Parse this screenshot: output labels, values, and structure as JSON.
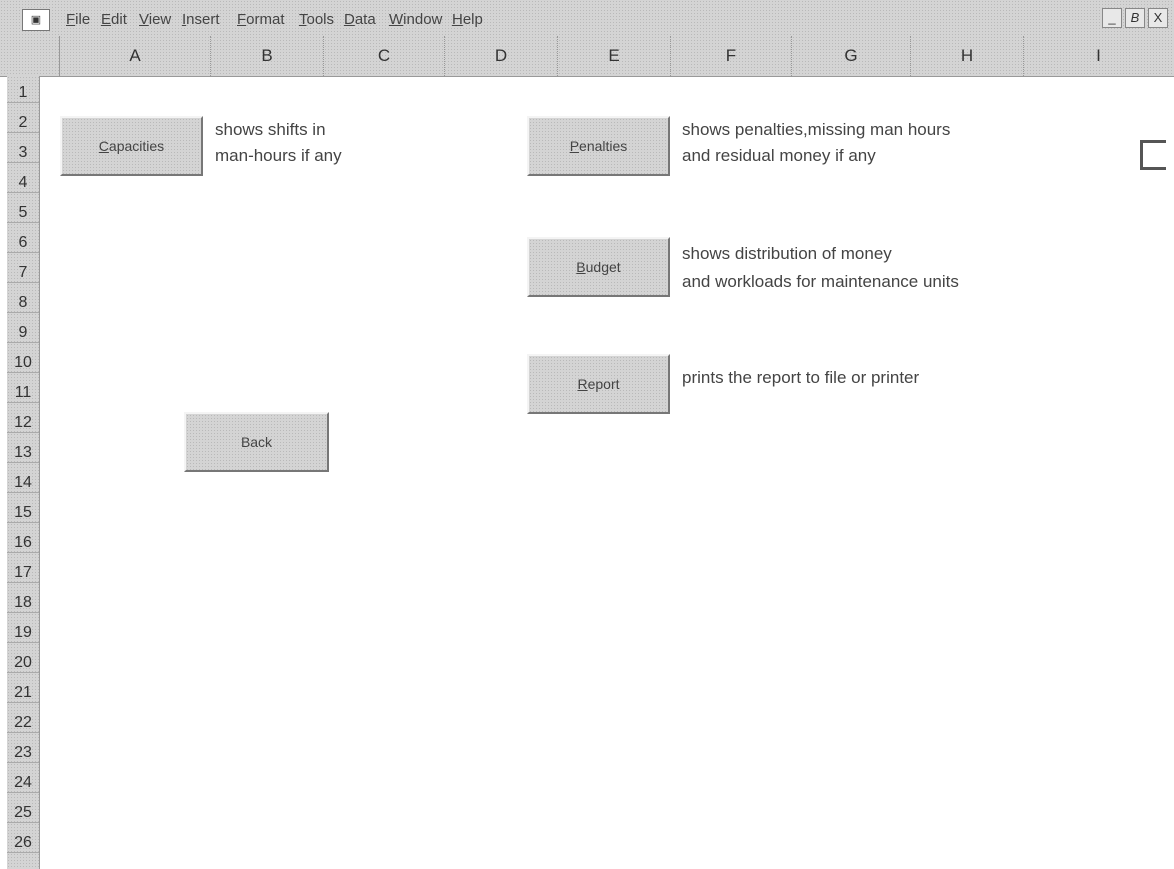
{
  "menu": {
    "app_icon": "▣",
    "items": [
      "File",
      "Edit",
      "View",
      "Insert",
      "Format",
      "Tools",
      "Data",
      "Window",
      "Help"
    ],
    "window_buttons": [
      "_",
      "B",
      "X"
    ]
  },
  "columns": [
    "A",
    "B",
    "C",
    "D",
    "E",
    "F",
    "G",
    "H",
    "I"
  ],
  "rows": [
    "1",
    "2",
    "3",
    "4",
    "5",
    "6",
    "7",
    "8",
    "9",
    "10",
    "11",
    "12",
    "13",
    "14",
    "15",
    "16",
    "17",
    "18",
    "19",
    "20",
    "21",
    "22",
    "23",
    "24",
    "25",
    "26"
  ],
  "sheet": {
    "capacities": {
      "button": "Capacities",
      "desc1": "shows shifts in",
      "desc2": "man-hours if any"
    },
    "penalties": {
      "button": "Penalties",
      "desc1": "shows penalties,missing man hours",
      "desc2": "and residual money if any"
    },
    "budget": {
      "button": "Budget",
      "desc1": "shows distribution of money",
      "desc2": "and workloads for maintenance units"
    },
    "report": {
      "button": "Report",
      "desc1": "prints the report to file or printer"
    },
    "back": {
      "button": "Back"
    }
  },
  "colors": {
    "chrome": "#d4d4d4",
    "grid_background": "#ffffff",
    "text": "#444444"
  }
}
